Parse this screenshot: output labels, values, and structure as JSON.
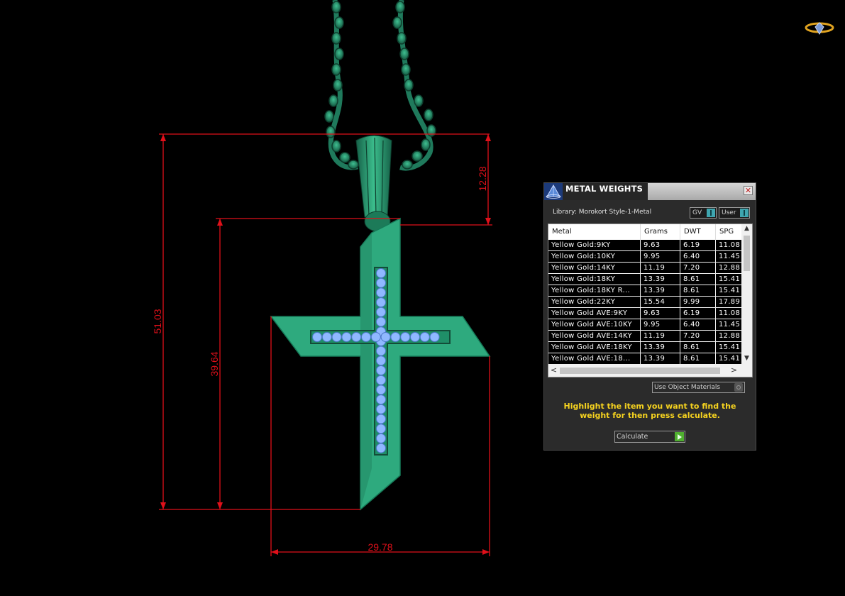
{
  "viewport": {
    "dimensions": {
      "overall_height": "51.03",
      "bail_height": "12.28",
      "cross_height": "39.64",
      "cross_width": "29.78"
    }
  },
  "panel": {
    "title": "METAL WEIGHTS",
    "close_glyph": "✕",
    "library_label": "Library: Morokort Style-1-Metal",
    "toggles": {
      "gv": "GV",
      "user": "User"
    },
    "columns": [
      "Metal",
      "Grams",
      "DWT",
      "SPG"
    ],
    "rows": [
      [
        "Yellow Gold:9KY",
        "9.63",
        "6.19",
        "11.08"
      ],
      [
        "Yellow Gold:10KY",
        "9.95",
        "6.40",
        "11.45"
      ],
      [
        "Yellow Gold:14KY",
        "11.19",
        "7.20",
        "12.88"
      ],
      [
        "Yellow Gold:18KY",
        "13.39",
        "8.61",
        "15.41"
      ],
      [
        "Yellow Gold:18KY R...",
        "13.39",
        "8.61",
        "15.41"
      ],
      [
        "Yellow Gold:22KY",
        "15.54",
        "9.99",
        "17.89"
      ],
      [
        "Yellow Gold AVE:9KY",
        "9.63",
        "6.19",
        "11.08"
      ],
      [
        "Yellow Gold AVE:10KY",
        "9.95",
        "6.40",
        "11.45"
      ],
      [
        "Yellow Gold AVE:14KY",
        "11.19",
        "7.20",
        "12.88"
      ],
      [
        "Yellow Gold AVE:18KY",
        "13.39",
        "8.61",
        "15.41"
      ],
      [
        "Yellow Gold AVE:18...",
        "13.39",
        "8.61",
        "15.41"
      ]
    ],
    "scroll_arrows": {
      "up": "▲",
      "down": "▼",
      "left": "<",
      "right": ">"
    },
    "use_object_materials": "Use Object Materials",
    "instruction": "Highlight the item you want to find the weight for then press calculate.",
    "calculate_label": "Calculate"
  },
  "icons": {
    "panel_icon": "pyramid-icon",
    "logo": "brand-logo-icon"
  },
  "colors": {
    "background": "#000000",
    "metal_green": "#2eaa7e",
    "chain_green": "#1f7a5c",
    "stone_blue": "#8fb8ff",
    "dimension_red": "#e0101a",
    "instruction_yellow": "#f5d21f"
  }
}
